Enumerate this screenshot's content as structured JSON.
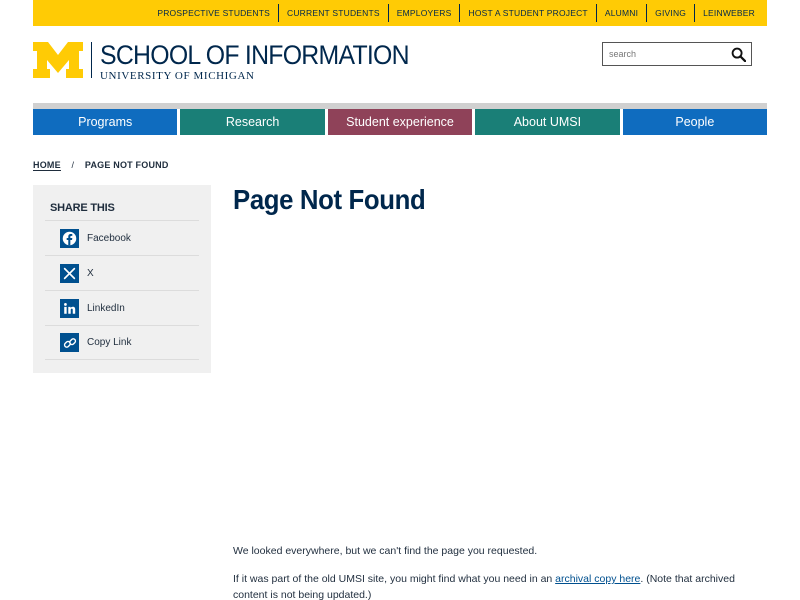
{
  "utility_nav": [
    "PROSPECTIVE STUDENTS",
    "CURRENT STUDENTS",
    "EMPLOYERS",
    "HOST A STUDENT PROJECT",
    "ALUMNI",
    "GIVING",
    "LEINWEBER"
  ],
  "header": {
    "title": "SCHOOL OF INFORMATION",
    "subtitle": "UNIVERSITY OF MICHIGAN",
    "search_placeholder": "search"
  },
  "main_nav": [
    {
      "label": "Programs",
      "color": "#0f6cbf"
    },
    {
      "label": "Research",
      "color": "#1a7f77"
    },
    {
      "label": "Student experience",
      "color": "#8f4259"
    },
    {
      "label": "About UMSI",
      "color": "#1a7f77"
    },
    {
      "label": "People",
      "color": "#0f6cbf"
    }
  ],
  "breadcrumb": {
    "home": "HOME",
    "separator": "/",
    "current": "PAGE NOT FOUND"
  },
  "share": {
    "title": "SHARE THIS",
    "items": [
      {
        "label": "Facebook",
        "icon": "facebook-icon"
      },
      {
        "label": "X",
        "icon": "x-icon"
      },
      {
        "label": "LinkedIn",
        "icon": "linkedin-icon"
      },
      {
        "label": "Copy Link",
        "icon": "link-icon"
      }
    ]
  },
  "main": {
    "title": "Page Not Found",
    "p1": "We looked everywhere, but we can't find the page you requested.",
    "p2_before": "If it was part of the old UMSI site, you might find what you need in an ",
    "p2_link": "archival copy here",
    "p2_after": ". (Note that archived content is not being updated.)"
  },
  "colors": {
    "maize": "#ffcb05",
    "blue": "#00274c",
    "icon_blue": "#00508f"
  }
}
